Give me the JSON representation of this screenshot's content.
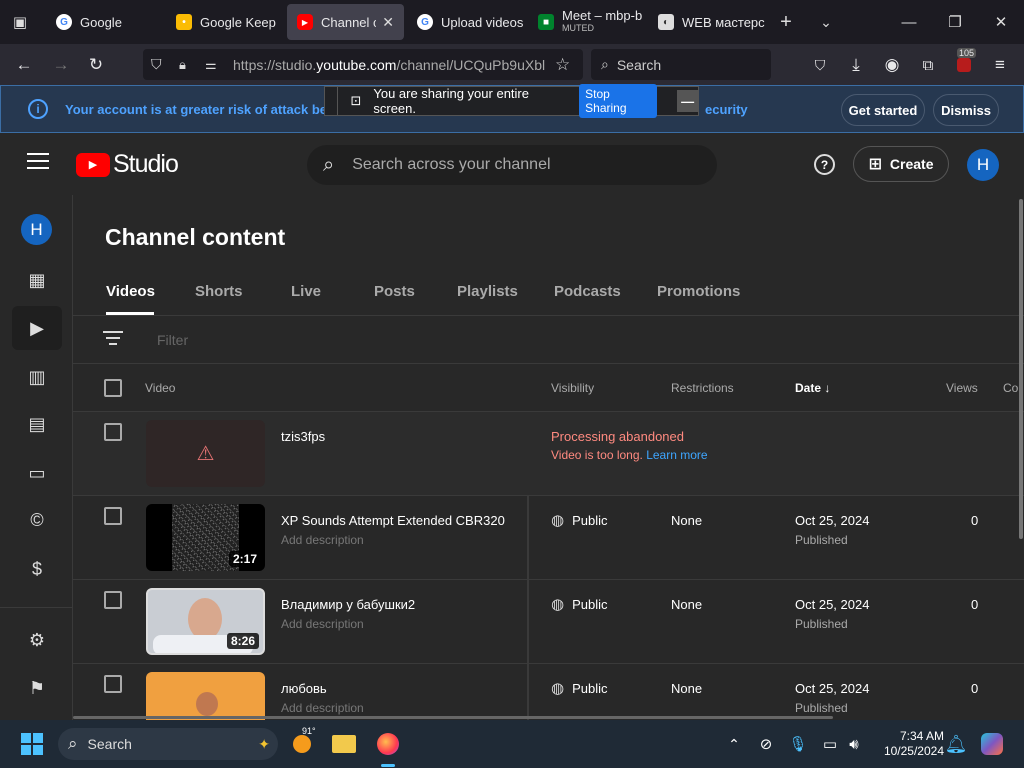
{
  "browser": {
    "tabs": [
      {
        "label": "Google"
      },
      {
        "label": "Google Keep"
      },
      {
        "label": "Channel co"
      },
      {
        "label": "Upload videos"
      },
      {
        "label": "Meet – mbp-b",
        "sub": "MUTED"
      },
      {
        "label": "WEB мастерс"
      }
    ],
    "url_prefix": "https://studio.",
    "url_host": "youtube.com",
    "url_path": "/channel/UCQuPb9uXbl",
    "search_placeholder": "Search",
    "badge_count": "105"
  },
  "banner": {
    "message": "Your account is at greater risk of attack beca",
    "message_tail": "ecurity",
    "get_started": "Get started",
    "dismiss": "Dismiss"
  },
  "share": {
    "text": "You are sharing your entire screen.",
    "stop": "Stop Sharing"
  },
  "studio": {
    "logo_text": "Studio",
    "search_placeholder": "Search across your channel",
    "create_label": "Create",
    "avatar_letter": "H"
  },
  "page": {
    "title": "Channel content",
    "tabs": [
      "Videos",
      "Shorts",
      "Live",
      "Posts",
      "Playlists",
      "Podcasts",
      "Promotions"
    ],
    "filter_placeholder": "Filter",
    "columns": {
      "video": "Video",
      "visibility": "Visibility",
      "restrictions": "Restrictions",
      "date": "Date",
      "views": "Views",
      "comments": "Cor"
    }
  },
  "videos": [
    {
      "title": "tzis3fps",
      "status": "Processing abandoned",
      "status_detail": "Video is too long.",
      "learn_more": "Learn more"
    },
    {
      "title": "XP Sounds Attempt Extended CBR320",
      "desc": "Add description",
      "duration": "2:17",
      "visibility": "Public",
      "restrictions": "None",
      "date": "Oct 25, 2024",
      "date_sub": "Published",
      "views": "0"
    },
    {
      "title": "Владимир у бабушки2",
      "desc": "Add description",
      "duration": "8:26",
      "visibility": "Public",
      "restrictions": "None",
      "date": "Oct 25, 2024",
      "date_sub": "Published",
      "views": "0"
    },
    {
      "title": "любовь",
      "desc": "Add description",
      "visibility": "Public",
      "restrictions": "None",
      "date": "Oct 25, 2024",
      "date_sub": "Published",
      "views": "0"
    }
  ],
  "taskbar": {
    "search_label": "Search",
    "weather": "91°",
    "time": "7:34 AM",
    "date": "10/25/2024"
  }
}
